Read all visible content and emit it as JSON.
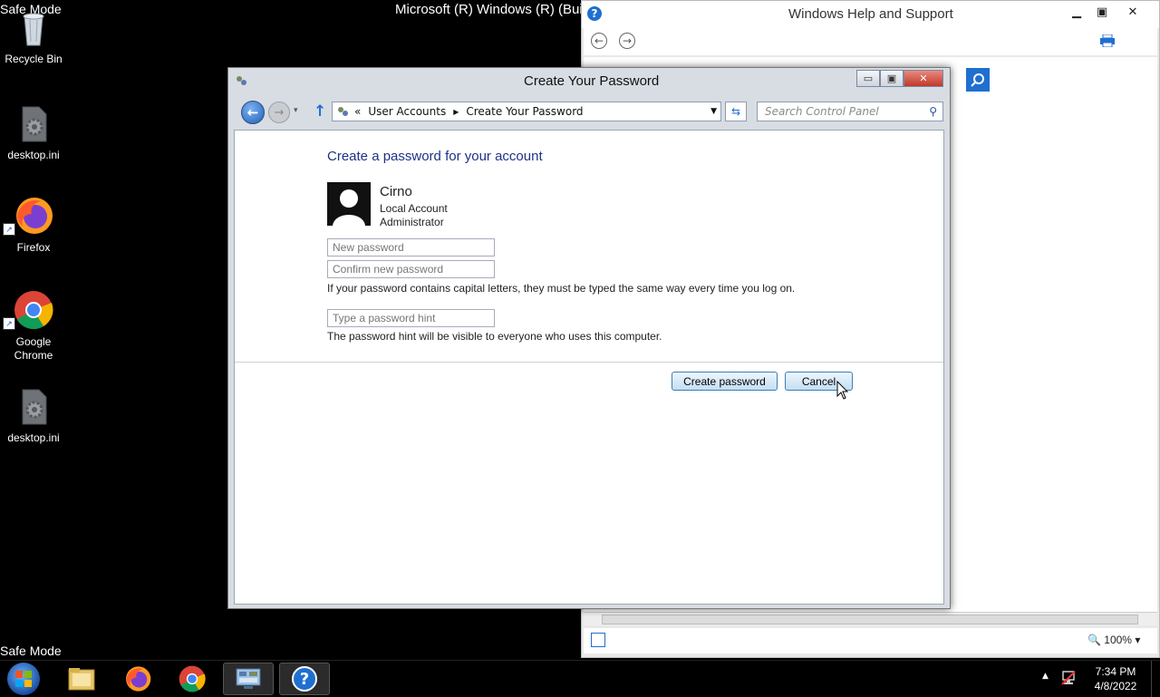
{
  "desktop": {
    "safe_mode_top": "Safe Mode",
    "safe_mode_bottom": "Safe Mode",
    "build_text": "Microsoft (R) Windows (R) (Bui",
    "icons": [
      {
        "label": "Recycle Bin",
        "icon": "recycle-bin-icon"
      },
      {
        "label": "desktop.ini",
        "icon": "settings-file-icon"
      },
      {
        "label": "Firefox",
        "icon": "firefox-icon"
      },
      {
        "label": "Google Chrome",
        "icon": "chrome-icon"
      },
      {
        "label": "desktop.ini",
        "icon": "settings-file-icon"
      }
    ]
  },
  "help_window": {
    "title": "Windows Help and Support",
    "zoom": "100%"
  },
  "dialog": {
    "title": "Create Your Password",
    "breadcrumb": [
      "User Accounts",
      "Create Your Password"
    ],
    "search_placeholder": "Search Control Panel",
    "heading": "Create a password for your account",
    "user": {
      "name": "Cirno",
      "account_type": "Local Account",
      "role": "Administrator"
    },
    "fields": {
      "new_password_placeholder": "New password",
      "confirm_password_placeholder": "Confirm new password",
      "hint_placeholder": "Type a password hint"
    },
    "notes": {
      "capital_letters": "If your password contains capital letters, they must be typed the same way every time you log on.",
      "hint_visibility": "The password hint will be visible to everyone who uses this computer."
    },
    "buttons": {
      "create": "Create password",
      "cancel": "Cancel"
    }
  },
  "taskbar": {
    "time": "7:34 PM",
    "date": "4/8/2022",
    "items": [
      "start-button",
      "file-explorer",
      "firefox",
      "chrome",
      "control-panel",
      "help-and-support"
    ]
  },
  "colors": {
    "heading": "#1e3287",
    "desktop_bg": "#000000",
    "button_border": "#3c7fb1"
  }
}
